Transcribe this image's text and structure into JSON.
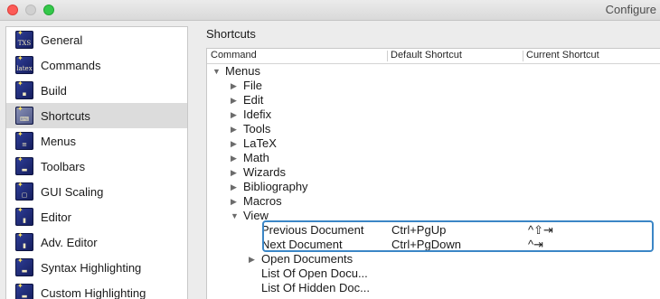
{
  "window": {
    "title": "Configure"
  },
  "sidebar": {
    "items": [
      {
        "label": "General",
        "icon": "txs-icon",
        "glyph": "TXS"
      },
      {
        "label": "Commands",
        "icon": "latex-icon",
        "glyph": "latex"
      },
      {
        "label": "Build",
        "icon": "build-icon",
        "glyph": "▪"
      },
      {
        "label": "Shortcuts",
        "icon": "keyboard-icon",
        "glyph": "⌨"
      },
      {
        "label": "Menus",
        "icon": "menu-icon",
        "glyph": "≡"
      },
      {
        "label": "Toolbars",
        "icon": "toolbar-icon",
        "glyph": "▬"
      },
      {
        "label": "GUI Scaling",
        "icon": "scaling-icon",
        "glyph": "▢"
      },
      {
        "label": "Editor",
        "icon": "editor-icon",
        "glyph": "▮"
      },
      {
        "label": "Adv. Editor",
        "icon": "adv-editor-icon",
        "glyph": "▮"
      },
      {
        "label": "Syntax Highlighting",
        "icon": "syntax-icon",
        "glyph": "▬"
      },
      {
        "label": "Custom Highlighting",
        "icon": "custom-highlight-icon",
        "glyph": "▬"
      }
    ],
    "selected": "Shortcuts"
  },
  "main": {
    "heading": "Shortcuts",
    "columns": [
      "Command",
      "Default Shortcut",
      "Current Shortcut"
    ],
    "rows": [
      {
        "label": "Menus",
        "level": 0,
        "arrow": "▼",
        "default": "",
        "current": ""
      },
      {
        "label": "File",
        "level": 1,
        "arrow": "▶",
        "default": "",
        "current": ""
      },
      {
        "label": "Edit",
        "level": 1,
        "arrow": "▶",
        "default": "",
        "current": ""
      },
      {
        "label": "Idefix",
        "level": 1,
        "arrow": "▶",
        "default": "",
        "current": ""
      },
      {
        "label": "Tools",
        "level": 1,
        "arrow": "▶",
        "default": "",
        "current": ""
      },
      {
        "label": "LaTeX",
        "level": 1,
        "arrow": "▶",
        "default": "",
        "current": ""
      },
      {
        "label": "Math",
        "level": 1,
        "arrow": "▶",
        "default": "",
        "current": ""
      },
      {
        "label": "Wizards",
        "level": 1,
        "arrow": "▶",
        "default": "",
        "current": ""
      },
      {
        "label": "Bibliography",
        "level": 1,
        "arrow": "▶",
        "default": "",
        "current": ""
      },
      {
        "label": "Macros",
        "level": 1,
        "arrow": "▶",
        "default": "",
        "current": ""
      },
      {
        "label": "View",
        "level": 1,
        "arrow": "▼",
        "default": "",
        "current": ""
      },
      {
        "label": "Previous Document",
        "level": 2,
        "arrow": "",
        "default": "Ctrl+PgUp",
        "current": "^⇧⇥"
      },
      {
        "label": "Next Document",
        "level": 2,
        "arrow": "",
        "default": "Ctrl+PgDown",
        "current": "^⇥"
      },
      {
        "label": "Open Documents",
        "level": 2,
        "arrow": "▶",
        "default": "",
        "current": ""
      },
      {
        "label": "List Of Open Docu...",
        "level": 2,
        "arrow": "",
        "default": "",
        "current": ""
      },
      {
        "label": "List Of Hidden Doc...",
        "level": 2,
        "arrow": "",
        "default": "",
        "current": ""
      }
    ]
  },
  "colors": {
    "highlight_border": "#3b86c6",
    "selected_bg": "#dcdcdc"
  }
}
